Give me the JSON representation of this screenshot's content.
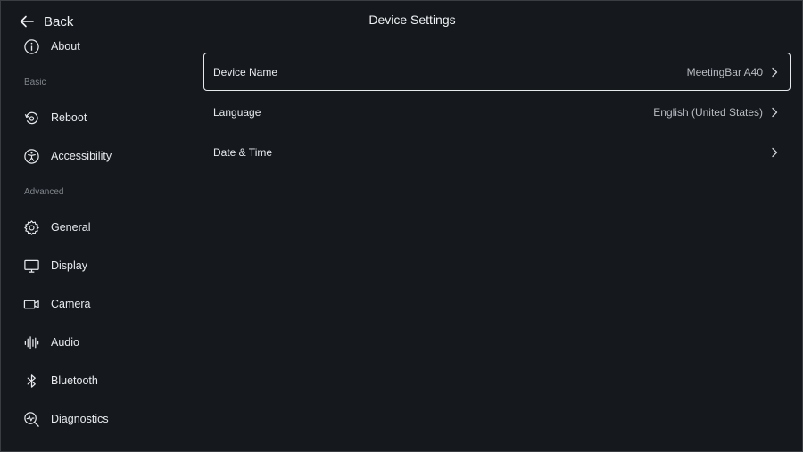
{
  "header": {
    "back_label": "Back",
    "title": "Device Settings"
  },
  "sidebar": {
    "items": [
      {
        "label": "About",
        "icon": "info-icon"
      },
      {
        "label": "Reboot",
        "icon": "reboot-icon"
      },
      {
        "label": "Accessibility",
        "icon": "accessibility-icon"
      },
      {
        "label": "General",
        "icon": "gear-icon"
      },
      {
        "label": "Display",
        "icon": "monitor-icon"
      },
      {
        "label": "Camera",
        "icon": "camera-icon"
      },
      {
        "label": "Audio",
        "icon": "audio-icon"
      },
      {
        "label": "Bluetooth",
        "icon": "bluetooth-icon"
      },
      {
        "label": "Diagnostics",
        "icon": "diagnostics-icon"
      }
    ],
    "sections": {
      "basic": "Basic",
      "advanced": "Advanced"
    }
  },
  "settings": {
    "rows": [
      {
        "label": "Device Name",
        "value": "MeetingBar A40"
      },
      {
        "label": "Language",
        "value": "English (United States)"
      },
      {
        "label": "Date & Time",
        "value": ""
      }
    ]
  },
  "colors": {
    "background": "#15191e",
    "text": "#e8eaed",
    "muted": "#7f858c",
    "focus_border": "#e6e8ea"
  }
}
